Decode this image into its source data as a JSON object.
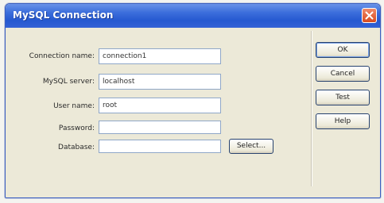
{
  "window": {
    "title": "MySQL Connection"
  },
  "form": {
    "connection_name": {
      "label": "Connection name:",
      "value": "connection1"
    },
    "mysql_server": {
      "label": "MySQL server:",
      "value": "localhost"
    },
    "user_name": {
      "label": "User name:",
      "value": "root"
    },
    "password": {
      "label": "Password:",
      "value": ""
    },
    "database": {
      "label": "Database:",
      "value": ""
    },
    "select_label": "Select..."
  },
  "buttons": {
    "ok": "OK",
    "cancel": "Cancel",
    "test": "Test",
    "help": "Help"
  },
  "icons": {
    "close": "close-icon"
  },
  "colors": {
    "titlebar": "#2558d0",
    "close": "#d84a1e",
    "dialog_bg": "#ece9d8"
  }
}
